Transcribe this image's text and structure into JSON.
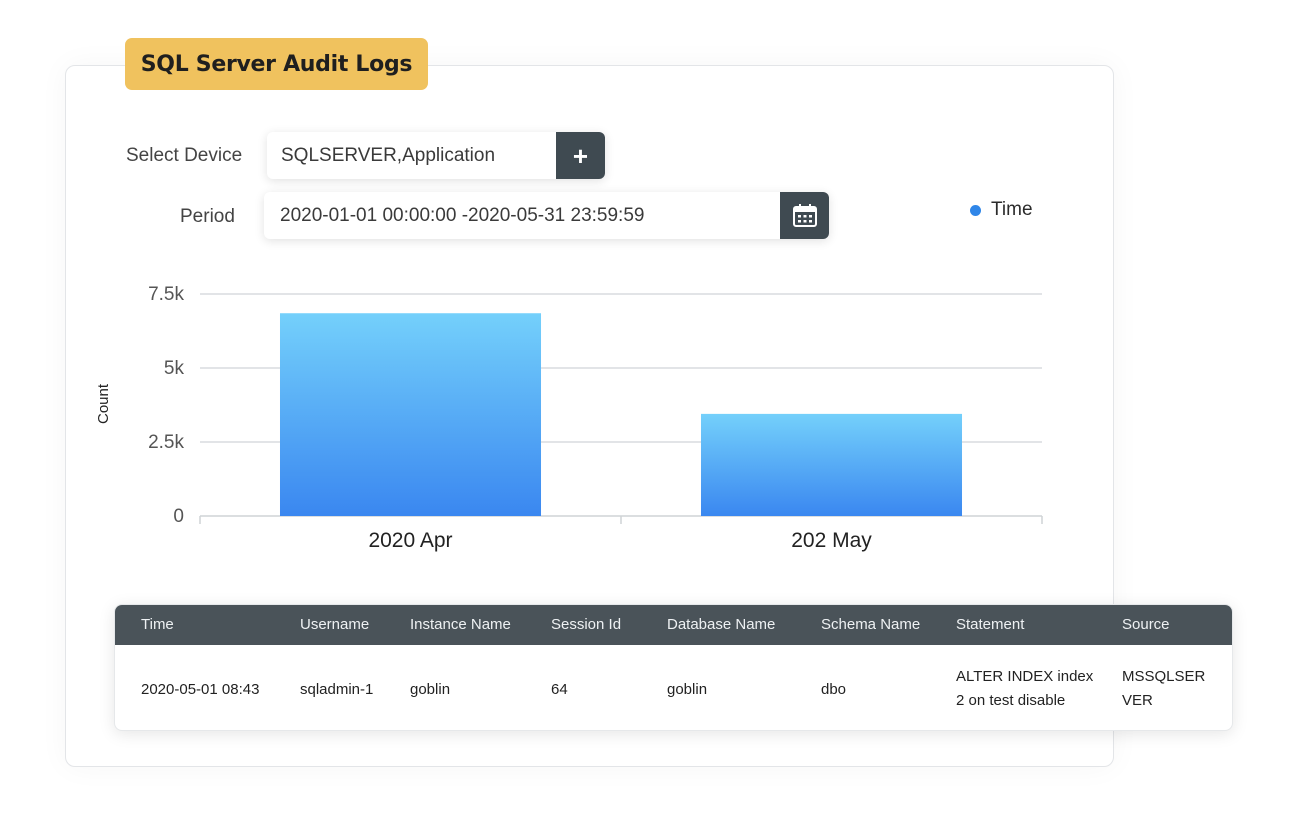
{
  "title": "SQL Server Audit Logs",
  "form": {
    "device_label": "Select Device",
    "device_value": "SQLSERVER,Application",
    "period_label": "Period",
    "period_value": "2020-01-01 00:00:00 -2020-05-31 23:59:59"
  },
  "icons": {
    "add": "plus-icon",
    "calendar": "calendar-icon"
  },
  "colors": {
    "accent": "#f0c25e",
    "header": "#4a5359",
    "bar_top": "#74d0fb",
    "bar_bottom": "#3a87f0",
    "legend": "#2f86e8"
  },
  "chart_data": {
    "type": "bar",
    "categories": [
      "2020 Apr",
      "202 May"
    ],
    "series": [
      {
        "name": "Time",
        "values": [
          6850,
          3450
        ]
      }
    ],
    "ylabel": "Count",
    "yticks": [
      "0",
      "2.5k",
      "5k",
      "7.5k"
    ],
    "ylim": [
      0,
      7500
    ],
    "grid": true,
    "legend_position": "top-right"
  },
  "table": {
    "headers": [
      "Time",
      "Username",
      "Instance Name",
      "Session Id",
      "Database Name",
      "Schema Name",
      "Statement",
      "Source"
    ],
    "rows": [
      {
        "time": "2020-05-01 08:43",
        "username": "sqladmin-1",
        "instance": "goblin",
        "session": "64",
        "database": "goblin",
        "schema": "dbo",
        "statement_1": "ALTER INDEX index",
        "statement_2": "2 on test disable",
        "source_1": "MSSQLSER",
        "source_2": "VER"
      }
    ]
  }
}
